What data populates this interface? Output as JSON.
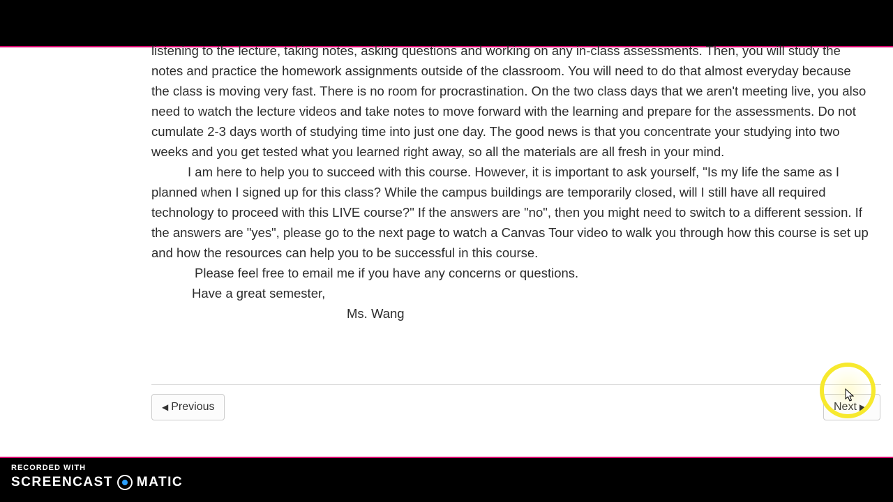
{
  "content": {
    "paragraph1": "listening to the lecture, taking notes, asking questions and working on any in-class assessments. Then, you will study the notes and practice the homework assignments outside of the classroom. You will need to do that almost everyday because the class is moving very fast. There is no room for procrastination. On the two class days that we aren't meeting live, you also need to watch the lecture videos and take notes to move forward with the learning and  prepare for the assessments. Do not cumulate 2-3 days worth of studying time into just one day. The good news is that you concentrate your studying into two weeks and you get tested what you learned right away, so all the materials are all fresh in your mind.",
    "paragraph2": "I am here to help you to succeed with this course. However, it is important to ask yourself, \"Is my life the same as I planned when I signed up for this class? While the campus buildings are temporarily closed, will I still have all required technology to proceed with this LIVE course?\" If the answers are \"no\", then you might need to switch to a different session. If the answers are \"yes\", please go to the next page to watch a Canvas Tour video to walk you through how this course is set up and how the resources can help you to be successful in this course.",
    "paragraph3": "Please feel free to email me if you have any concerns or questions.",
    "closing": "Have a great semester,",
    "signature": "Ms. Wang"
  },
  "nav": {
    "previous": "Previous",
    "next": "Next"
  },
  "watermark": {
    "recorded_with": "RECORDED WITH",
    "brand_left": "SCREENCAST",
    "brand_right": "MATIC"
  }
}
